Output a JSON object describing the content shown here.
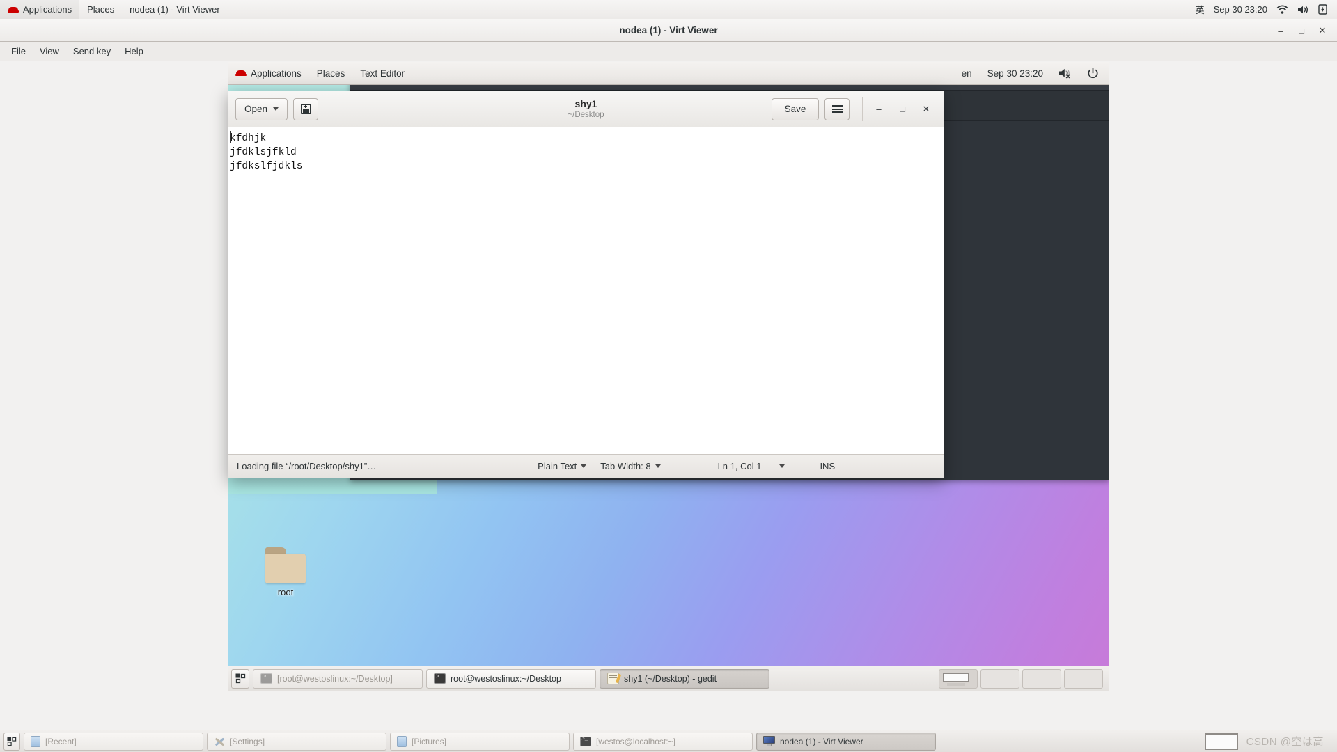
{
  "host_panel": {
    "redhat_icon": "redhat-icon",
    "applications_label": "Applications",
    "places_label": "Places",
    "window_label": "nodea (1) - Virt Viewer",
    "input_method": "英",
    "clock": "Sep 30  23:20",
    "wifi_icon": "wifi-icon",
    "volume_icon": "volume-icon",
    "battery_icon": "battery-charging-icon"
  },
  "virt_viewer": {
    "title": "nodea (1) - Virt Viewer",
    "minimize": "–",
    "maximize": "□",
    "close": "✕",
    "menus": [
      "File",
      "View",
      "Send key",
      "Help"
    ]
  },
  "guest_panel": {
    "redhat_icon": "redhat-icon",
    "applications_label": "Applications",
    "places_label": "Places",
    "active_app_label": "Text Editor",
    "keyboard_layout": "en",
    "clock": "Sep 30  23:20",
    "volume_icon": "volume-muted-icon",
    "power_icon": "power-icon"
  },
  "desktop": {
    "folder_label": "root"
  },
  "gedit": {
    "open_label": "Open",
    "new_document_icon": "save-as-icon",
    "doc_title": "shy1",
    "doc_path": "~/Desktop",
    "save_label": "Save",
    "menu_icon": "hamburger-icon",
    "minimize": "–",
    "maximize": "□",
    "close": "✕",
    "content": "kfdhjk\njfdklsjfkld\njfdkslfjdkls",
    "statusbar": {
      "message": "Loading file “/root/Desktop/shy1”…",
      "language": "Plain Text",
      "tab_width": "Tab Width: 8",
      "position": "Ln 1, Col 1",
      "insert_mode": "INS"
    }
  },
  "guest_taskbar": {
    "show_desktop_icon": "show-desktop-icon",
    "windows": [
      {
        "label": "[root@westoslinux:~/Desktop]",
        "icon": "terminal-icon",
        "state": "minimized"
      },
      {
        "label": "root@westoslinux:~/Desktop",
        "icon": "terminal-icon",
        "state": "normal"
      },
      {
        "label": "shy1 (~/Desktop) - gedit",
        "icon": "gedit-icon",
        "state": "active"
      }
    ],
    "workspaces": 4,
    "active_workspace": 1
  },
  "host_taskbar": {
    "show_desktop_icon": "show-desktop-icon",
    "windows": [
      {
        "label": "[Recent]",
        "icon": "file-manager-icon",
        "state": "minimized"
      },
      {
        "label": "[Settings]",
        "icon": "settings-tools-icon",
        "state": "minimized"
      },
      {
        "label": "[Pictures]",
        "icon": "file-manager-icon",
        "state": "minimized"
      },
      {
        "label": "[westos@localhost:~]",
        "icon": "terminal-icon",
        "state": "minimized"
      },
      {
        "label": "nodea (1) - Virt Viewer",
        "icon": "monitor-icon",
        "state": "active"
      }
    ],
    "watermark": "CSDN @空は高"
  }
}
